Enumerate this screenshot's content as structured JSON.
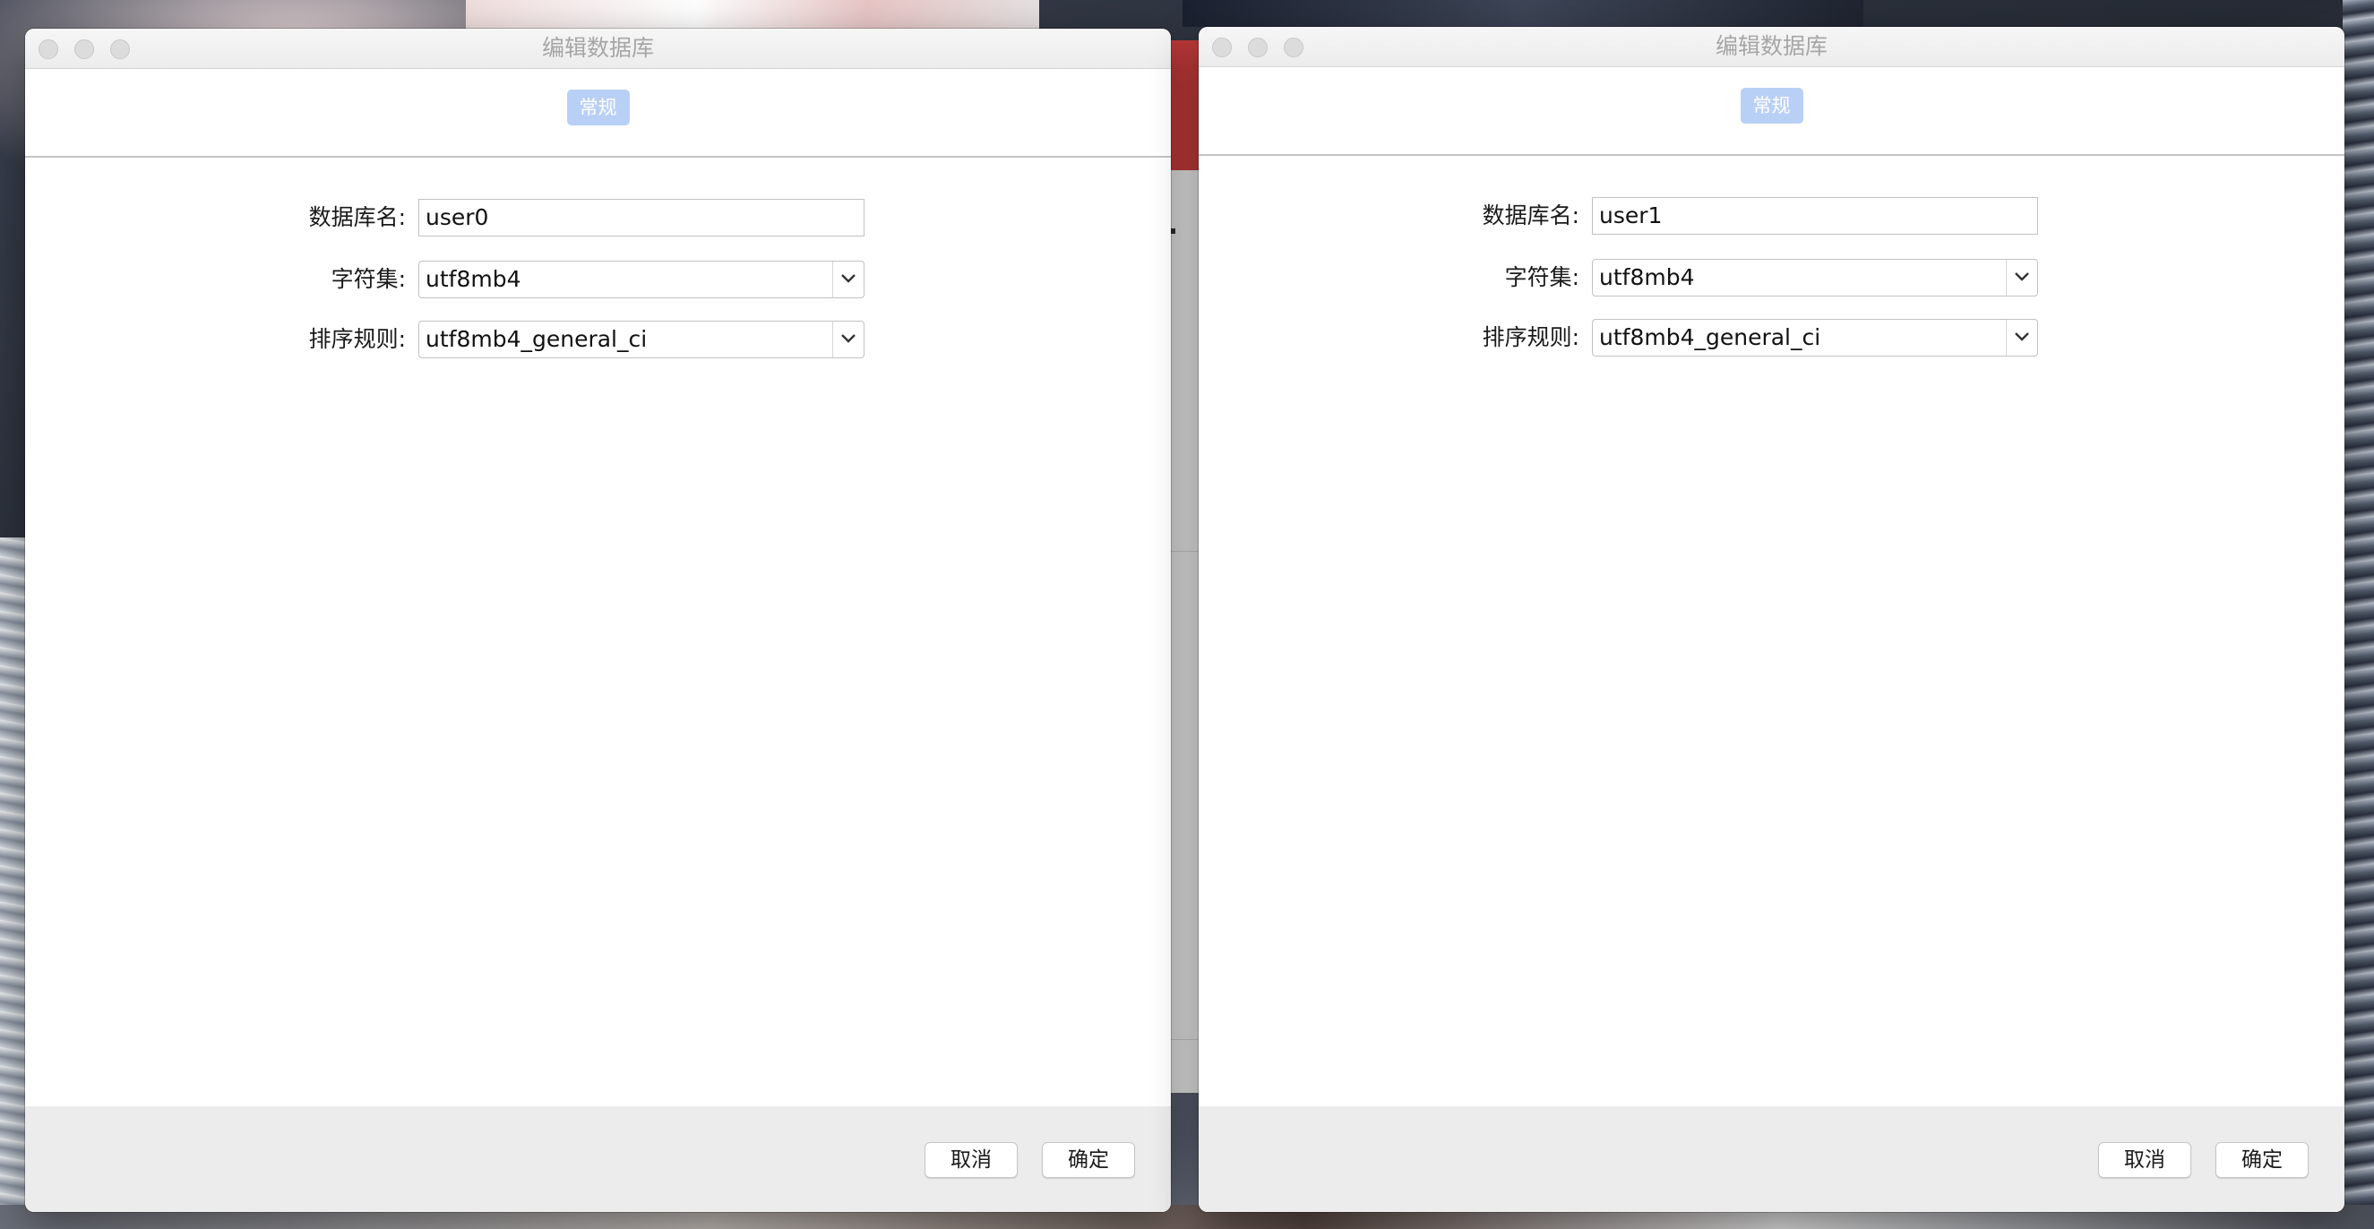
{
  "dialogs": [
    {
      "title": "编辑数据库",
      "tab_label": "常规",
      "fields": {
        "db_name_label": "数据库名:",
        "db_name_value": "user0",
        "charset_label": "字符集:",
        "charset_value": "utf8mb4",
        "collation_label": "排序规则:",
        "collation_value": "utf8mb4_general_ci"
      },
      "buttons": {
        "cancel": "取消",
        "ok": "确定"
      }
    },
    {
      "title": "编辑数据库",
      "tab_label": "常规",
      "fields": {
        "db_name_label": "数据库名:",
        "db_name_value": "user1",
        "charset_label": "字符集:",
        "charset_value": "utf8mb4",
        "collation_label": "排序规则:",
        "collation_value": "utf8mb4_general_ci"
      },
      "buttons": {
        "cancel": "取消",
        "ok": "确定"
      }
    }
  ],
  "colors": {
    "tab_active_bg": "#b9d0f6",
    "footer_bg": "#ececec",
    "title_text": "#a6a6a6"
  },
  "icons": [
    "close-icon",
    "minimize-icon",
    "zoom-icon",
    "chevron-down-icon"
  ]
}
